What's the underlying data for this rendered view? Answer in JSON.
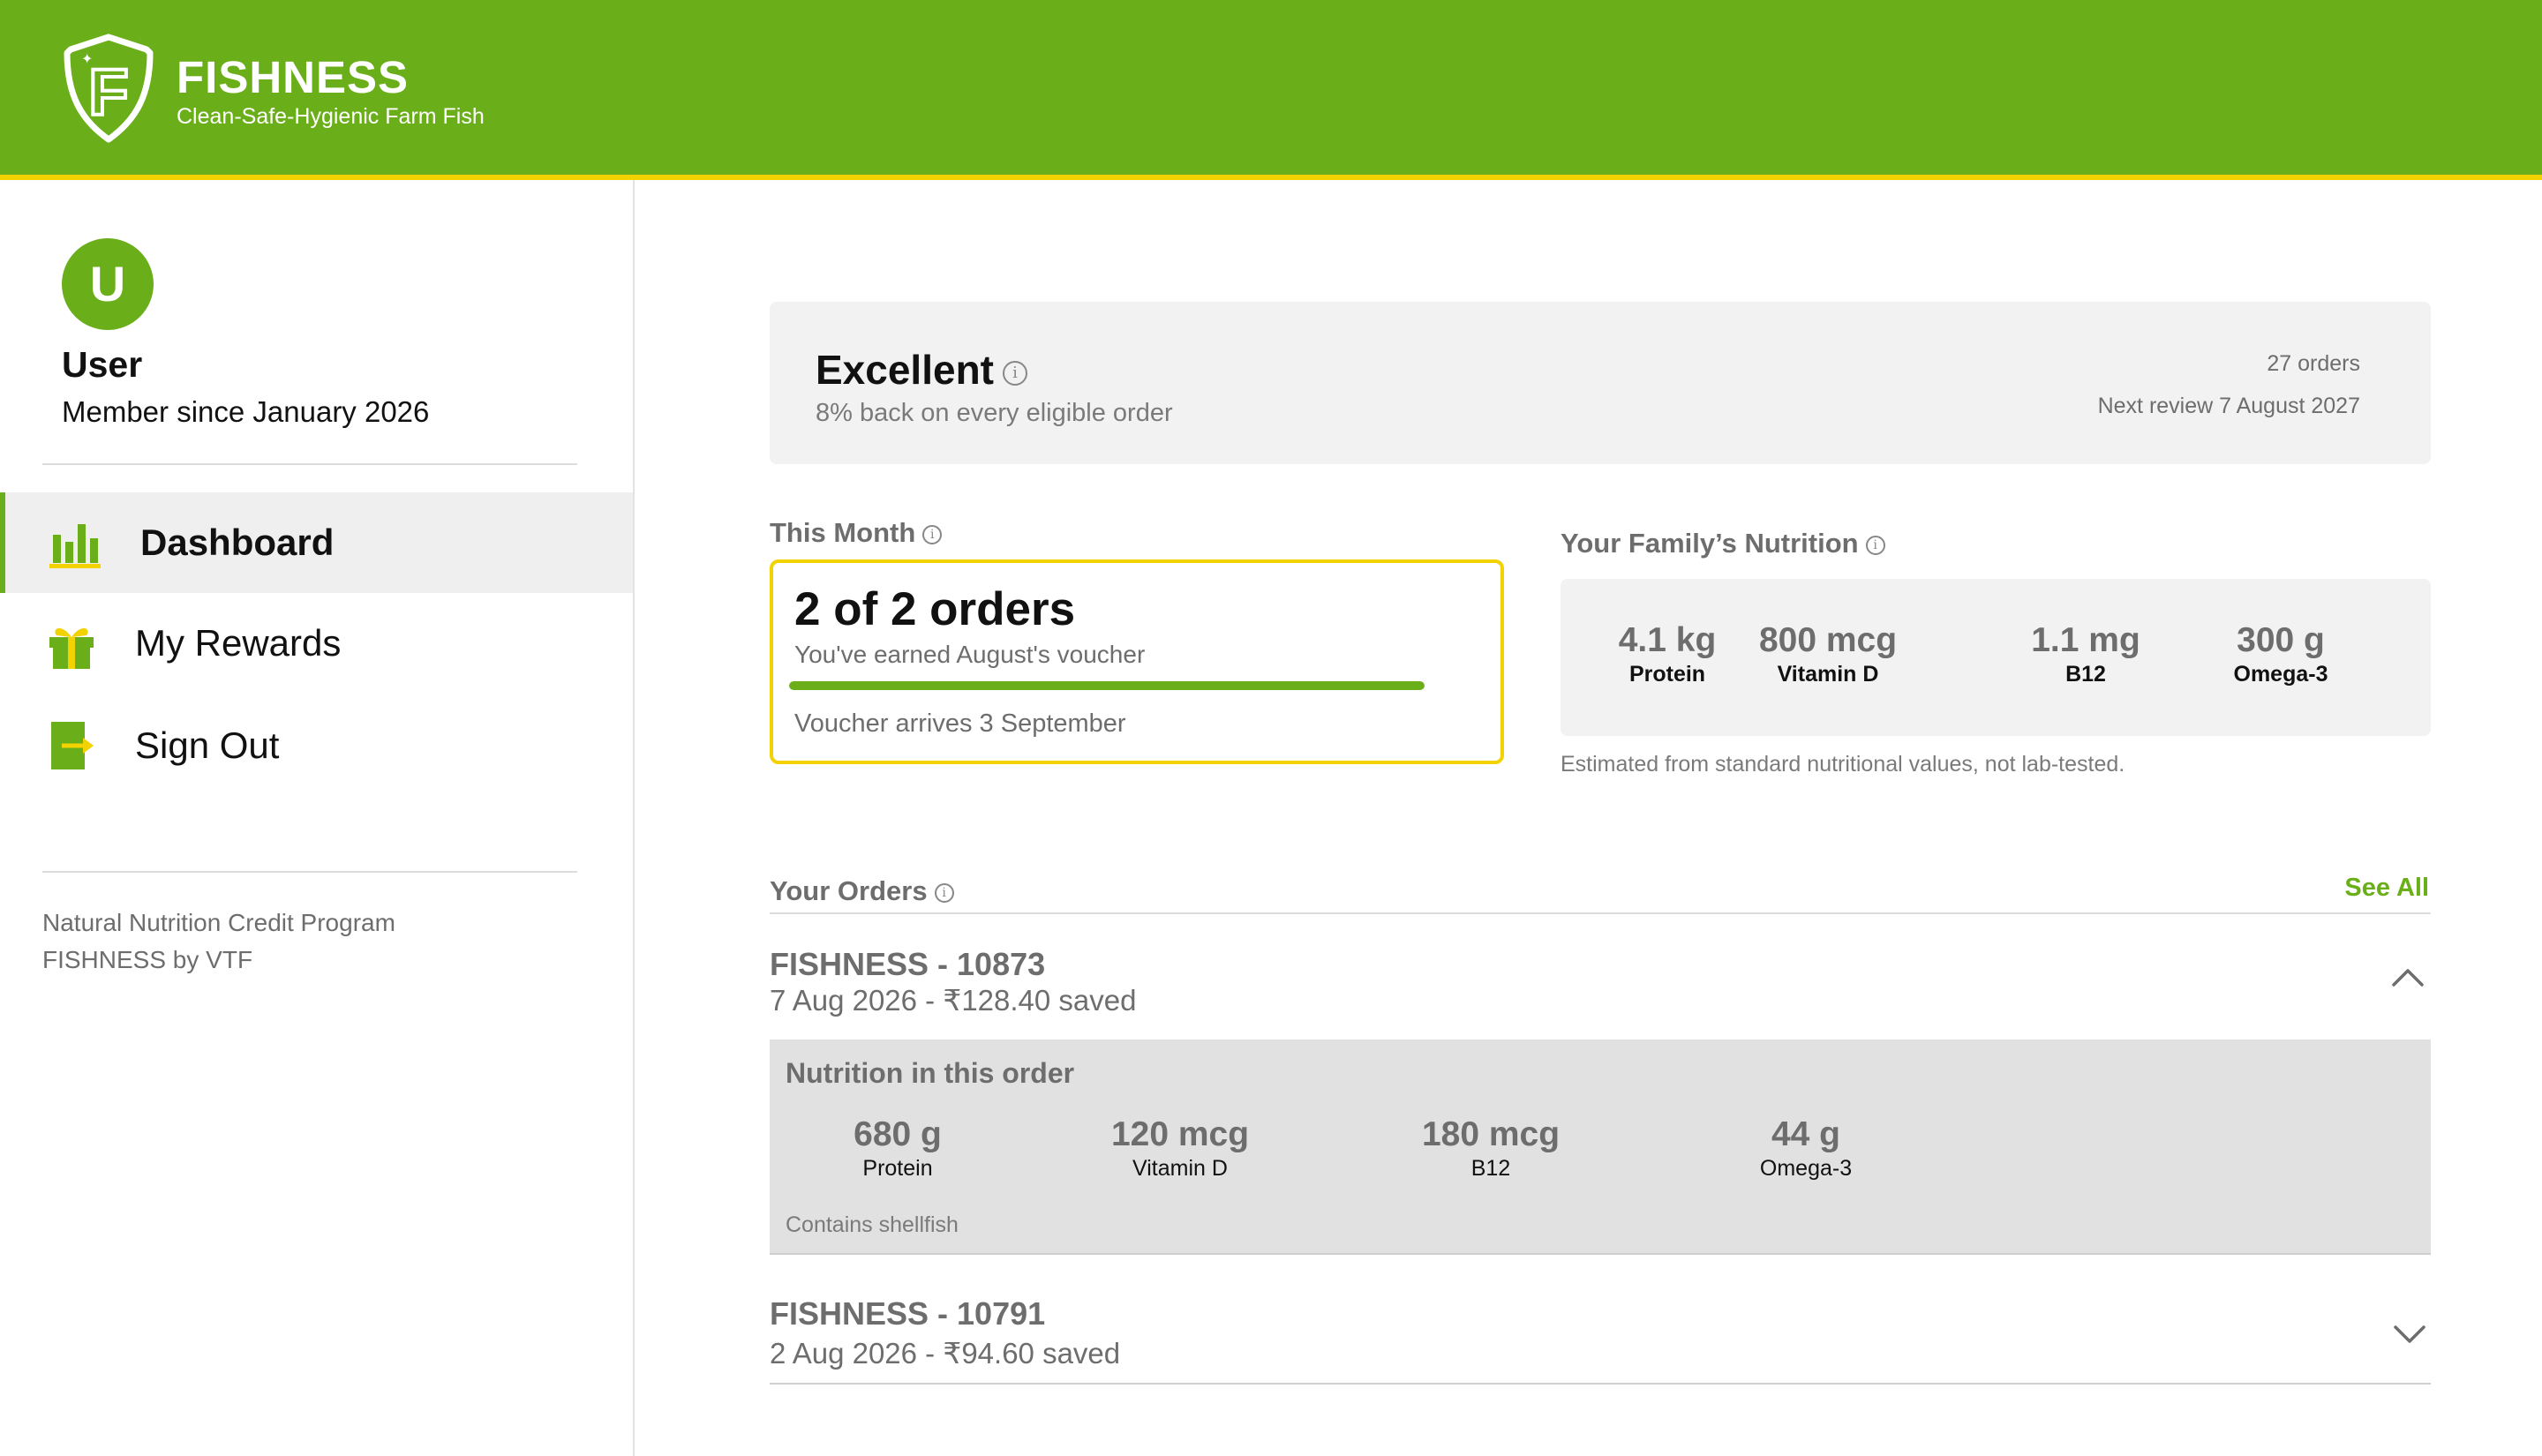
{
  "brand": {
    "name": "FISHNESS",
    "tagline": "Clean-Safe-Hygienic Farm Fish",
    "logo_letter": "F",
    "color_primary": "#6aaf1a",
    "color_accent": "#f2d200"
  },
  "user": {
    "initial": "U",
    "name": "User",
    "member_since": "Member since January 2026"
  },
  "nav": [
    {
      "label": "Dashboard",
      "icon": "bar-chart-icon",
      "active": true
    },
    {
      "label": "My Rewards",
      "icon": "gift-icon",
      "active": false
    },
    {
      "label": "Sign Out",
      "icon": "sign-out-icon",
      "active": false
    }
  ],
  "sidebar_footer": {
    "line1": "Natural Nutrition Credit Program",
    "line2": "FISHNESS by VTF"
  },
  "tier": {
    "title": "Excellent",
    "subtitle": "8% back on every eligible order",
    "orders": "27 orders",
    "next_review": "Next review 7 August 2027"
  },
  "this_month": {
    "label": "This Month",
    "headline": "2 of 2 orders",
    "subtext": "You've earned August's voucher",
    "progress_percent": 100,
    "arrival": "Voucher arrives 3 September"
  },
  "family_nutrition": {
    "label": "Your Family’s Nutrition",
    "metrics": [
      {
        "value": "4.1 kg",
        "label": "Protein"
      },
      {
        "value": "800 mcg",
        "label": "Vitamin D"
      },
      {
        "value": "1.1 mg",
        "label": "B12"
      },
      {
        "value": "300 g",
        "label": "Omega-3"
      }
    ],
    "note": "Estimated from standard nutritional values, not lab-tested."
  },
  "orders": {
    "label": "Your Orders",
    "see_all": "See All",
    "items": [
      {
        "id": "FISHNESS - 10873",
        "meta": "7 Aug 2026 - ₹128.40 saved",
        "expanded": true,
        "detail_title": "Nutrition in this order",
        "nutrition": [
          {
            "value": "680 g",
            "label": "Protein"
          },
          {
            "value": "120 mcg",
            "label": "Vitamin D"
          },
          {
            "value": "180 mcg",
            "label": "B12"
          },
          {
            "value": "44 g",
            "label": "Omega-3"
          }
        ],
        "note": "Contains shellfish"
      },
      {
        "id": "FISHNESS - 10791",
        "meta": "2 Aug 2026 - ₹94.60 saved",
        "expanded": false
      }
    ]
  }
}
